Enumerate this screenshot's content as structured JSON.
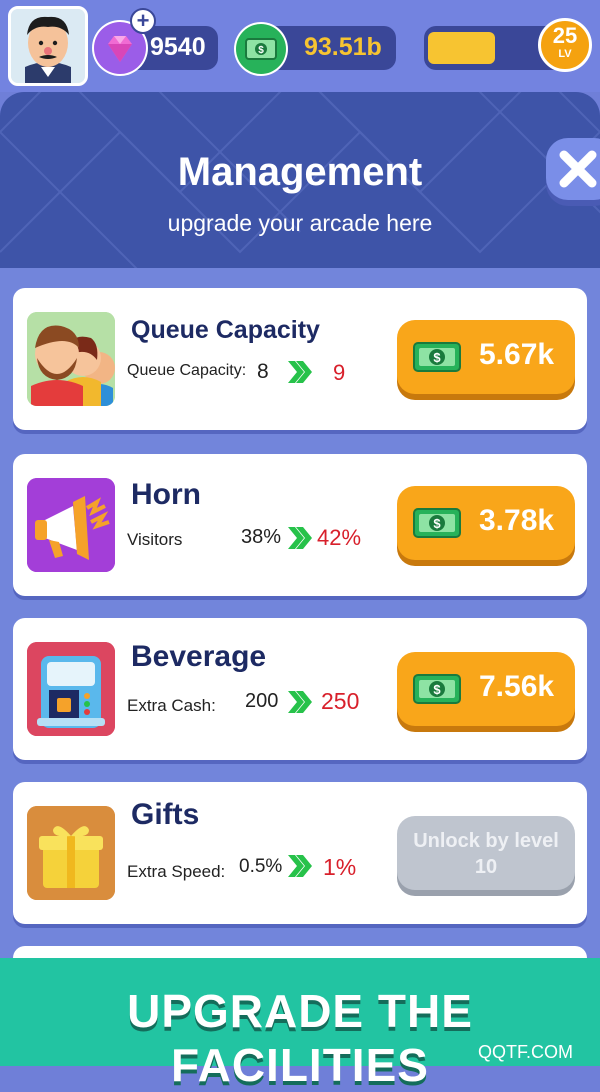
{
  "hud": {
    "gems": "9540",
    "cash": "93.51b",
    "xp_progress": 0.45,
    "level": "25",
    "level_label": "LV",
    "gem_icon": "diamond-icon",
    "cash_icon": "dollar-bill-icon"
  },
  "header": {
    "title": "Management",
    "subtitle": "upgrade your arcade here"
  },
  "items": [
    {
      "name": "Queue Capacity",
      "stat_label": "Queue Capacity:",
      "old_value": "8",
      "new_value": "9",
      "price": "5.67k",
      "icon": "people-queue-icon"
    },
    {
      "name": "Horn",
      "stat_label": "Visitors",
      "old_value": "38%",
      "new_value": "42%",
      "price": "3.78k",
      "icon": "megaphone-icon"
    },
    {
      "name": "Beverage",
      "stat_label": "Extra Cash:",
      "old_value": "200",
      "new_value": "250",
      "price": "7.56k",
      "icon": "coffee-machine-icon"
    },
    {
      "name": "Gifts",
      "stat_label": "Extra Speed:",
      "old_value": "0.5%",
      "new_value": "1%",
      "locked_line1": "Unlock by level",
      "locked_line2": "10",
      "icon": "gift-box-icon"
    }
  ],
  "banner": {
    "text": "UPGRADE THE FACILITIES",
    "watermark": "QQTF.COM"
  },
  "colors": {
    "accent_orange": "#f9a61a",
    "header_blue": "#3e54a8",
    "increase_red": "#d8202b",
    "arrow_green": "#27c24a",
    "banner_teal": "#22c4a2"
  }
}
